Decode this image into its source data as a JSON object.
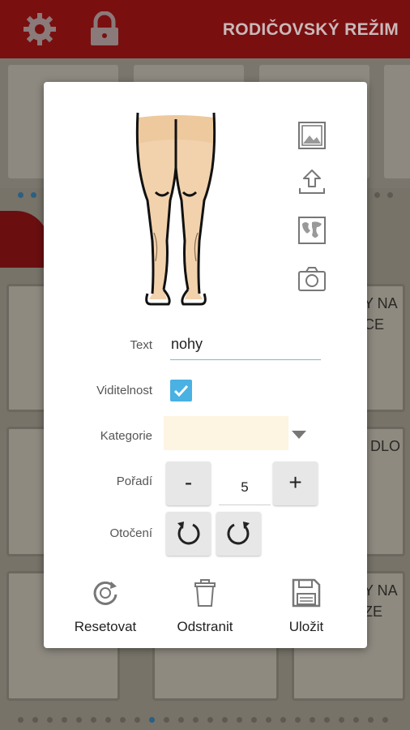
{
  "header": {
    "title": "RODIČOVSKÝ REŽIM",
    "settings_icon": "gear-icon",
    "lock_icon": "lock-icon"
  },
  "background_board": {
    "tile_texts": [
      "Y NA\nCE",
      "DLO",
      "Y NA\nZE"
    ]
  },
  "dialog": {
    "image_alt": "legs-pictogram",
    "side_icons": [
      "image-gallery-icon",
      "upload-icon",
      "world-map-icon",
      "camera-icon"
    ],
    "fields": {
      "text_label": "Text",
      "text_value": "nohy",
      "visibility_label": "Viditelnost",
      "visibility_checked": true,
      "category_label": "Kategorie",
      "category_value": "",
      "order_label": "Pořadí",
      "order_value": "5",
      "order_minus": "-",
      "order_plus": "+",
      "rotation_label": "Otočení"
    },
    "actions": {
      "reset_label": "Resetovat",
      "delete_label": "Odstranit",
      "save_label": "Uložit"
    }
  },
  "colors": {
    "header_bg": "#7a0f10",
    "accent_blue": "#4ab1e3",
    "category_bg": "#fdf5e1"
  }
}
